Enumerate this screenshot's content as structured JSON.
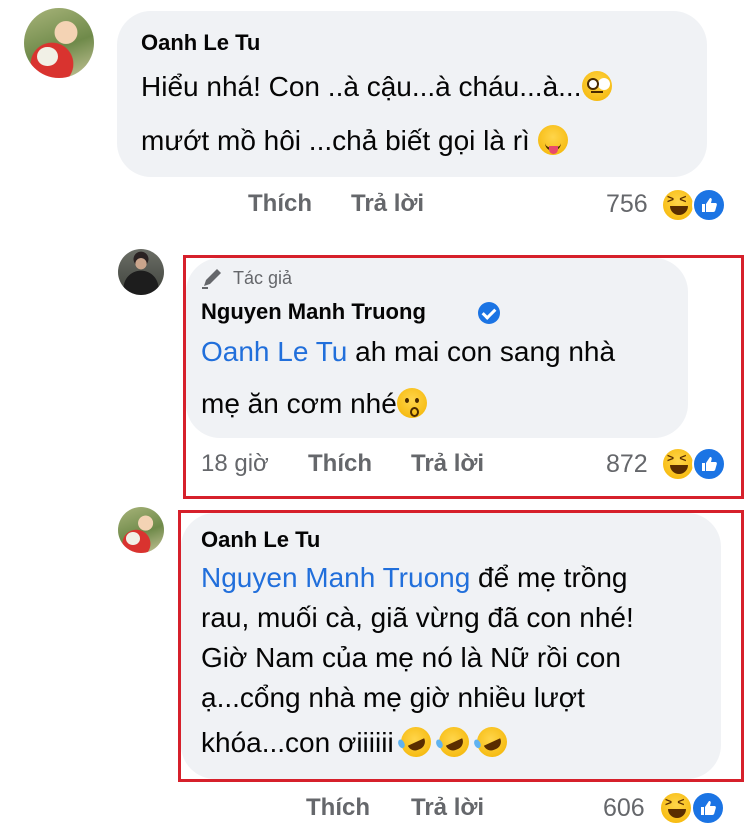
{
  "comments": [
    {
      "author": "Oanh Le Tu",
      "text_line1": "Hiểu nhá! Con ..à cậu...à cháu...à...",
      "text_line2": "mướt mồ hôi ...chả biết gọi là rì",
      "actions": {
        "like": "Thích",
        "reply": "Trả lời"
      },
      "reaction_count": "756",
      "emoji_1": "face-with-rolling-eyes",
      "emoji_2": "face-with-tongue"
    },
    {
      "author_badge": "Tác giả",
      "author": "Nguyen Manh Truong",
      "mention": "Oanh Le Tu",
      "text_line1": " ah mai con sang nhà",
      "text_line2": "mẹ ăn cơm nhé",
      "time": "18 giờ",
      "actions": {
        "like": "Thích",
        "reply": "Trả lời"
      },
      "reaction_count": "872",
      "emoji_1": "kissing-face"
    },
    {
      "author": "Oanh Le Tu",
      "mention": "Nguyen Manh Truong",
      "text_line1": " để mẹ trồng",
      "text_line2": "rau, muối cà, giã vừng đã con nhé!",
      "text_line3": "Giờ Nam của mẹ nó là Nữ rồi con",
      "text_line4": "ạ...cổng nhà mẹ giờ nhiều lượt",
      "text_line5": "khóa...con ơiiiiii",
      "actions": {
        "like": "Thích",
        "reply": "Trả lời"
      },
      "reaction_count": "606",
      "emoji_1": "rolling-on-floor-laughing"
    }
  ],
  "colors": {
    "bubble": "#f0f2f5",
    "mention": "#216fdb",
    "highlight_border": "#d6202b",
    "meta_text": "#65676b",
    "like_blue": "#1b74e4"
  }
}
